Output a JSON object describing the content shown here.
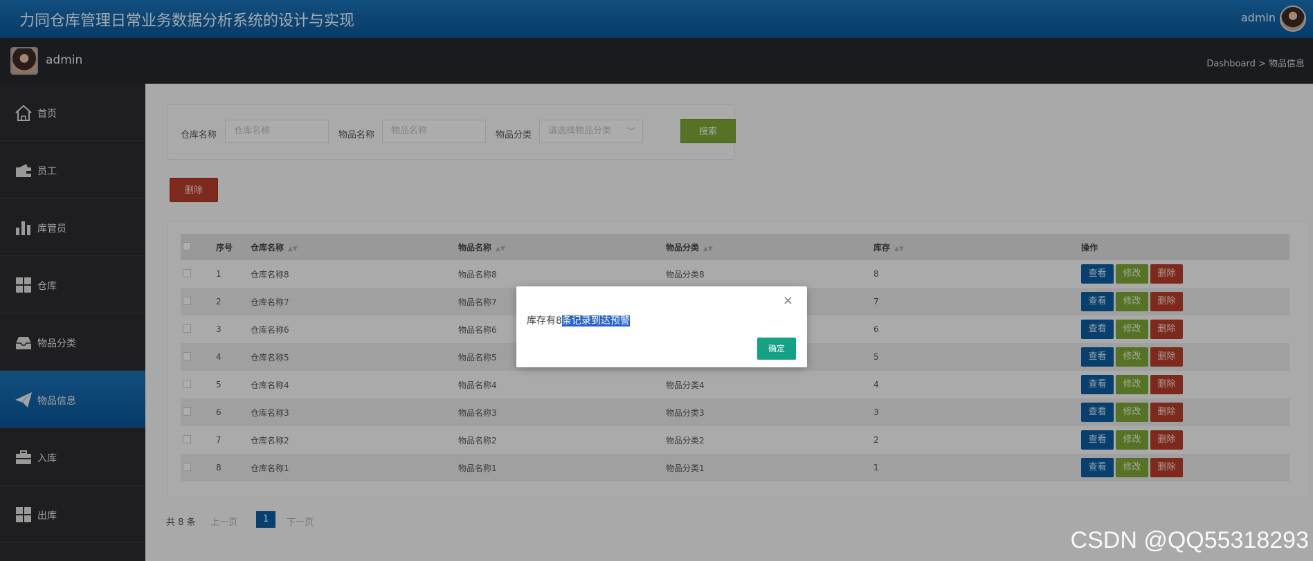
{
  "header": {
    "title": "力同仓库管理日常业务数据分析系统的设计与实现",
    "user": "admin"
  },
  "subbar": {
    "username": "admin",
    "breadcrumb": "Dashboard > 物品信息"
  },
  "sidebar": {
    "items": [
      {
        "label": "首页",
        "icon": "home-icon"
      },
      {
        "label": "员工",
        "icon": "wallet-icon"
      },
      {
        "label": "库管员",
        "icon": "bar-chart-icon"
      },
      {
        "label": "仓库",
        "icon": "grid-icon"
      },
      {
        "label": "物品分类",
        "icon": "inbox-icon"
      },
      {
        "label": "物品信息",
        "icon": "paper-plane-icon",
        "active": true
      },
      {
        "label": "入库",
        "icon": "briefcase-icon"
      },
      {
        "label": "出库",
        "icon": "grid-icon"
      }
    ]
  },
  "search": {
    "warehouse_label": "仓库名称",
    "warehouse_placeholder": "仓库名称",
    "item_label": "物品名称",
    "item_placeholder": "物品名称",
    "category_label": "物品分类",
    "category_placeholder": "请选择物品分类",
    "search_button": "搜索"
  },
  "toolbar": {
    "delete_button": "删除"
  },
  "table": {
    "headers": [
      "序号",
      "仓库名称",
      "物品名称",
      "物品分类",
      "库存",
      "操作"
    ],
    "rows": [
      {
        "no": "1",
        "warehouse": "仓库名称8",
        "item": "物品名称8",
        "category": "物品分类8",
        "stock": "8"
      },
      {
        "no": "2",
        "warehouse": "仓库名称7",
        "item": "物品名称7",
        "category": "",
        "stock": "7"
      },
      {
        "no": "3",
        "warehouse": "仓库名称6",
        "item": "物品名称6",
        "category": "",
        "stock": "6"
      },
      {
        "no": "4",
        "warehouse": "仓库名称5",
        "item": "物品名称5",
        "category": "",
        "stock": "5"
      },
      {
        "no": "5",
        "warehouse": "仓库名称4",
        "item": "物品名称4",
        "category": "物品分类4",
        "stock": "4"
      },
      {
        "no": "6",
        "warehouse": "仓库名称3",
        "item": "物品名称3",
        "category": "物品分类3",
        "stock": "3"
      },
      {
        "no": "7",
        "warehouse": "仓库名称2",
        "item": "物品名称2",
        "category": "物品分类2",
        "stock": "2"
      },
      {
        "no": "8",
        "warehouse": "仓库名称1",
        "item": "物品名称1",
        "category": "物品分类1",
        "stock": "1"
      }
    ],
    "actions": {
      "view": "查看",
      "edit": "修改",
      "delete": "删除"
    }
  },
  "pager": {
    "total": "共 8 条",
    "prev": "上一页",
    "current": "1",
    "next": "下一页"
  },
  "dialog": {
    "message_prefix": "库存有8",
    "message_selected": "条记录到达预警",
    "ok_button": "确定",
    "close": "×"
  },
  "watermark": "CSDN @QQ55318293"
}
